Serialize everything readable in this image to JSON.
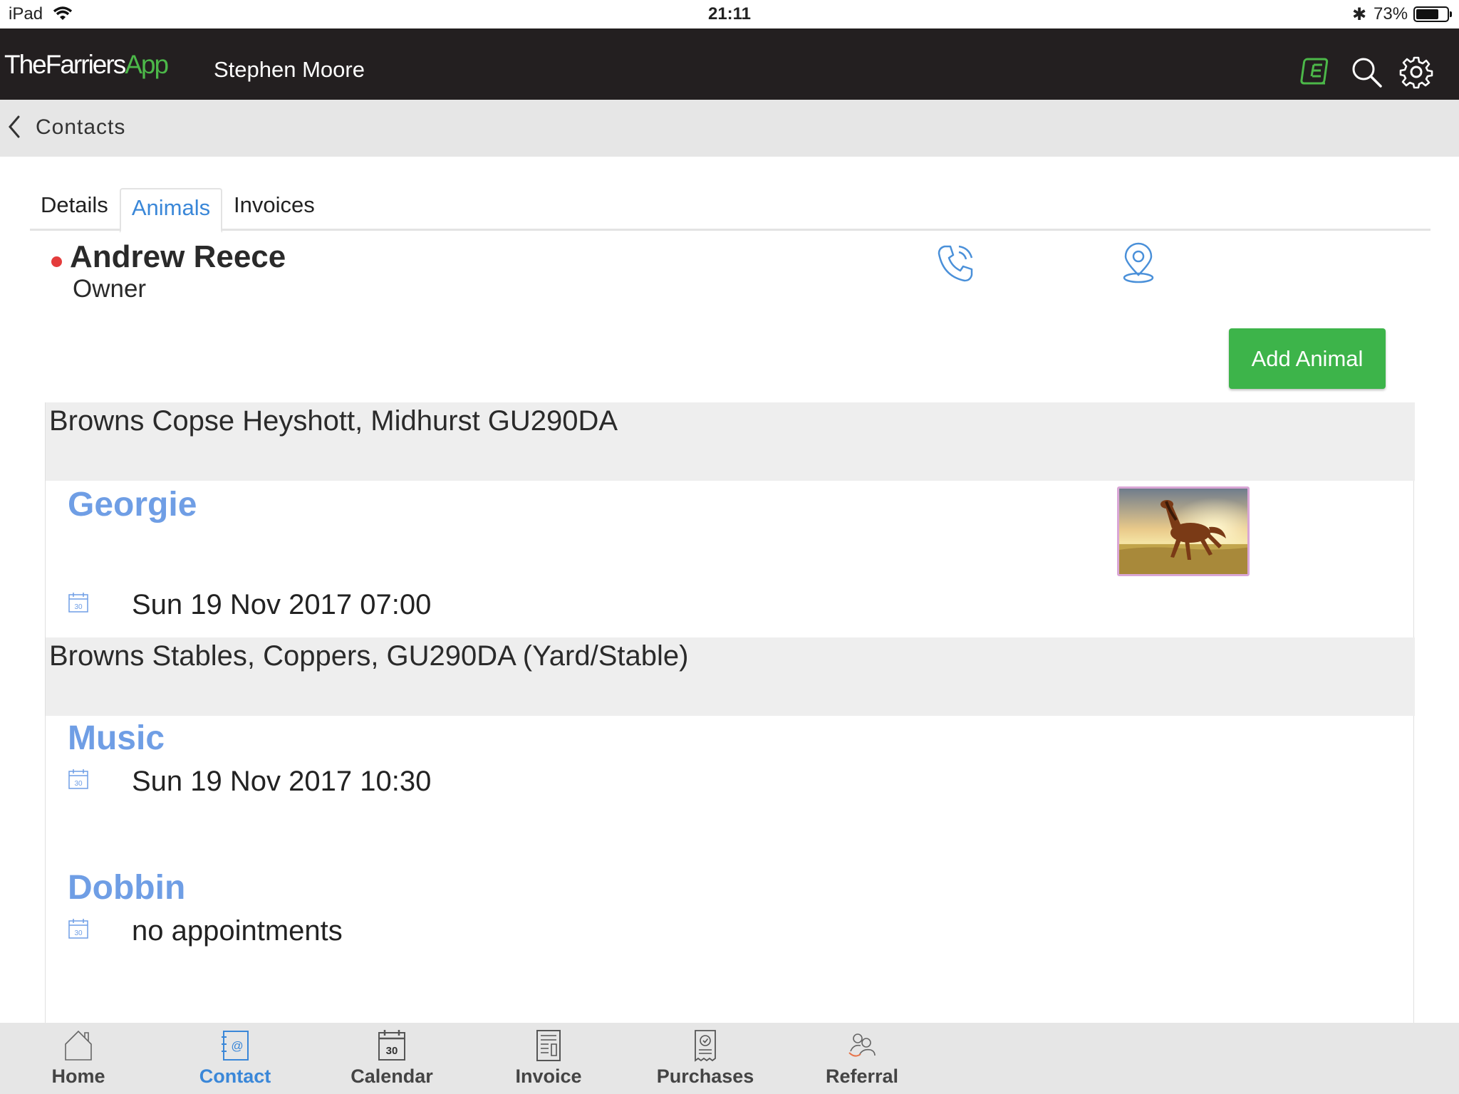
{
  "status_bar": {
    "carrier": "iPad",
    "time": "21:11",
    "battery": "73%",
    "battery_level": 0.73
  },
  "header": {
    "logo_main": "TheFarriers",
    "logo_app": "App",
    "user": "Stephen Moore",
    "icons": [
      "ebook-icon",
      "search-icon",
      "gear-icon"
    ]
  },
  "nav": {
    "back_label": "Contacts"
  },
  "tabs": [
    {
      "label": "Details",
      "active": false
    },
    {
      "label": "Animals",
      "active": true
    },
    {
      "label": "Invoices",
      "active": false
    }
  ],
  "owner": {
    "name": "Andrew Reece",
    "role": "Owner",
    "status_color": "#e43c3c"
  },
  "add_animal_label": "Add Animal",
  "locations": [
    {
      "address": "Browns Copse Heyshott, Midhurst GU290DA",
      "animals": [
        {
          "name": "Georgie",
          "appointment": "Sun 19 Nov 2017 07:00",
          "has_photo": true
        }
      ]
    },
    {
      "address": "Browns Stables, Coppers, GU290DA (Yard/Stable)",
      "animals": [
        {
          "name": "Music",
          "appointment": "Sun 19 Nov 2017 10:30"
        },
        {
          "name": "Dobbin",
          "appointment": "no appointments"
        }
      ]
    }
  ],
  "calendar_icon_day": "30",
  "bottom_tabs": [
    {
      "label": "Home",
      "icon": "home-icon",
      "active": false
    },
    {
      "label": "Contact",
      "icon": "contact-book-icon",
      "active": true
    },
    {
      "label": "Calendar",
      "icon": "calendar-icon",
      "active": false
    },
    {
      "label": "Invoice",
      "icon": "invoice-icon",
      "active": false
    },
    {
      "label": "Purchases",
      "icon": "receipt-icon",
      "active": false
    },
    {
      "label": "Referral",
      "icon": "referral-icon",
      "active": false
    }
  ],
  "colors": {
    "header_bg": "#231f20",
    "brand_green": "#4cb849",
    "accent_blue": "#3a87d8",
    "animal_name": "#6f9ee5",
    "button_green": "#3db44a"
  }
}
